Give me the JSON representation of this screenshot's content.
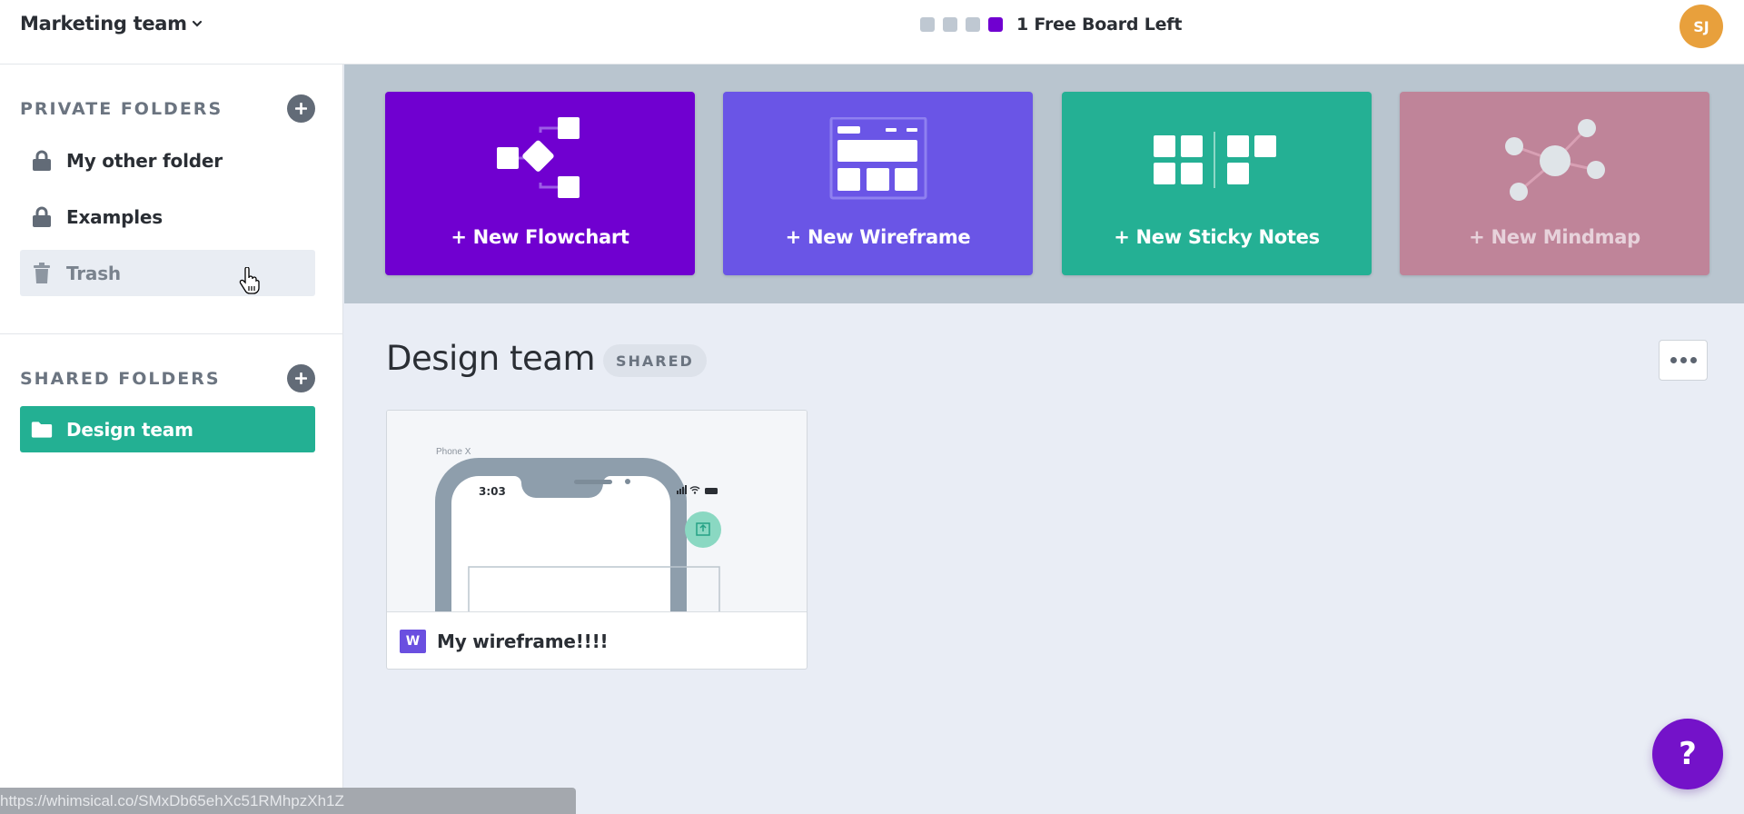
{
  "header": {
    "team_name": "Marketing team",
    "quota": {
      "total_boards": 4,
      "used_boards": 1,
      "label": "1 Free Board Left"
    },
    "avatar_initials": "SJ"
  },
  "sidebar": {
    "private_section": {
      "title": "PRIVATE FOLDERS",
      "items": [
        {
          "label": "My other folder",
          "icon": "lock-icon"
        },
        {
          "label": "Examples",
          "icon": "lock-icon"
        },
        {
          "label": "Trash",
          "icon": "trash-icon",
          "state": "hover"
        }
      ]
    },
    "shared_section": {
      "title": "SHARED FOLDERS",
      "items": [
        {
          "label": "Design team",
          "icon": "folder-icon",
          "state": "active"
        }
      ]
    }
  },
  "templates": [
    {
      "label": "+ New Flowchart",
      "color": "#7000d0"
    },
    {
      "label": "+ New Wireframe",
      "color": "#6a55e6"
    },
    {
      "label": "+ New Sticky Notes",
      "color": "#24b094"
    },
    {
      "label": "+ New Mindmap",
      "color": "#bf8499"
    }
  ],
  "folder": {
    "title": "Design team",
    "badge": "SHARED",
    "boards": [
      {
        "name": "My wireframe!!!!",
        "type_badge": "W",
        "thumbnail": {
          "device_label": "Phone X",
          "clock": "3:03"
        }
      }
    ]
  },
  "help_label": "?",
  "status_bar_url": "https://whimsical.co/SMxDb65ehXc51RMhpzXh1Z",
  "colors": {
    "accent_purple": "#7000d0",
    "active_folder": "#23b093",
    "avatar": "#e8a03c"
  }
}
